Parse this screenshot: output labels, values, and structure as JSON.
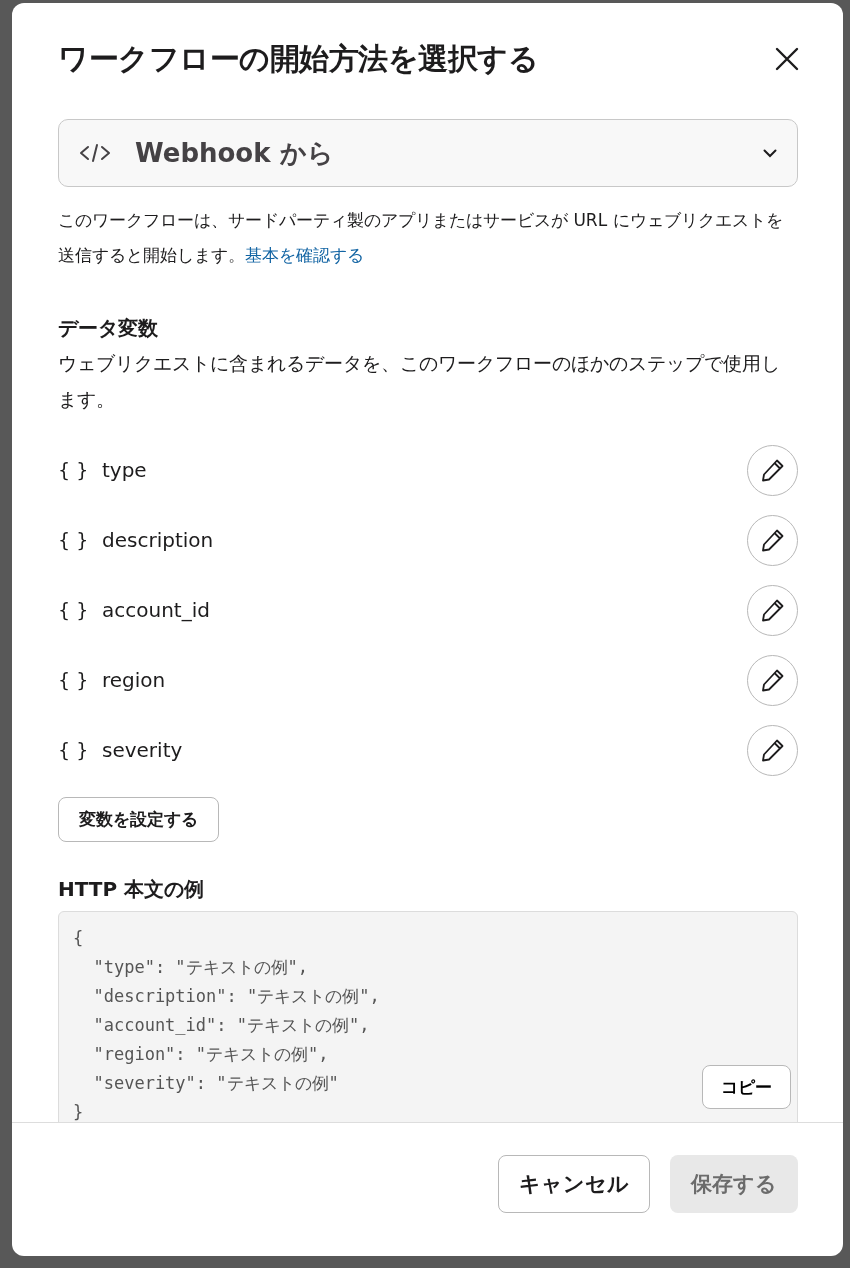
{
  "dialog": {
    "title": "ワークフローの開始方法を選択する"
  },
  "trigger_select": {
    "value": "Webhook から"
  },
  "description": {
    "text": "このワークフローは、サードパーティ製のアプリまたはサービスが URL にウェブリクエストを送信すると開始します。",
    "link": "基本を確認する"
  },
  "data_variables": {
    "heading": "データ変数",
    "subtext": "ウェブリクエストに含まれるデータを、このワークフローのほかのステップで使用します。",
    "icon_text": "{ }",
    "items": [
      {
        "name": "type"
      },
      {
        "name": "description"
      },
      {
        "name": "account_id"
      },
      {
        "name": "region"
      },
      {
        "name": "severity"
      }
    ],
    "set_button": "変数を設定する"
  },
  "http_example": {
    "heading": "HTTP 本文の例",
    "lines": [
      "{",
      "  \"type\": \"テキストの例\",",
      "  \"description\": \"テキストの例\",",
      "  \"account_id\": \"テキストの例\",",
      "  \"region\": \"テキストの例\",",
      "  \"severity\": \"テキストの例\"",
      "}"
    ],
    "copy_button": "コピー"
  },
  "footer": {
    "buttons": [
      {
        "label": "キャンセル",
        "kind": "secondary",
        "disabled": false
      },
      {
        "label": "保存する",
        "kind": "primary",
        "disabled": true
      }
    ]
  }
}
